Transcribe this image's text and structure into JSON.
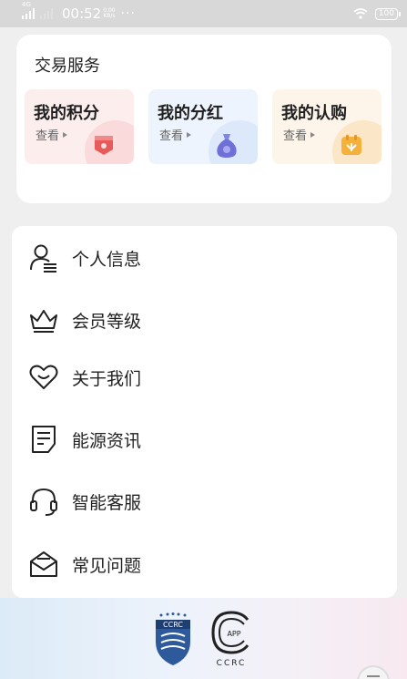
{
  "status_bar": {
    "network": "4G",
    "time": "00:52",
    "speed_value": "0.00",
    "speed_unit": "KB/s",
    "more": "···",
    "battery": "100"
  },
  "trade": {
    "title": "交易服务",
    "tiles": [
      {
        "title": "我的积分",
        "action": "查看",
        "bg": "#fdeeee",
        "icon": "points-badge-icon"
      },
      {
        "title": "我的分红",
        "action": "查看",
        "bg": "#eef4fd",
        "icon": "money-bag-icon"
      },
      {
        "title": "我的认购",
        "action": "查看",
        "bg": "#fdf5ea",
        "icon": "subscription-box-icon"
      }
    ]
  },
  "menu": {
    "items": [
      {
        "label": "个人信息",
        "icon": "user-profile-icon"
      },
      {
        "label": "会员等级",
        "icon": "crown-icon"
      },
      {
        "label": "关于我们",
        "icon": "heart-smile-icon"
      },
      {
        "label": "能源资讯",
        "icon": "news-document-icon"
      },
      {
        "label": "智能客服",
        "icon": "headset-icon"
      },
      {
        "label": "常见问题",
        "icon": "mail-question-icon"
      }
    ]
  },
  "footer": {
    "logo1_text": "CCRC",
    "logo2_text": "CCRC",
    "logo2_badge": "APP"
  }
}
